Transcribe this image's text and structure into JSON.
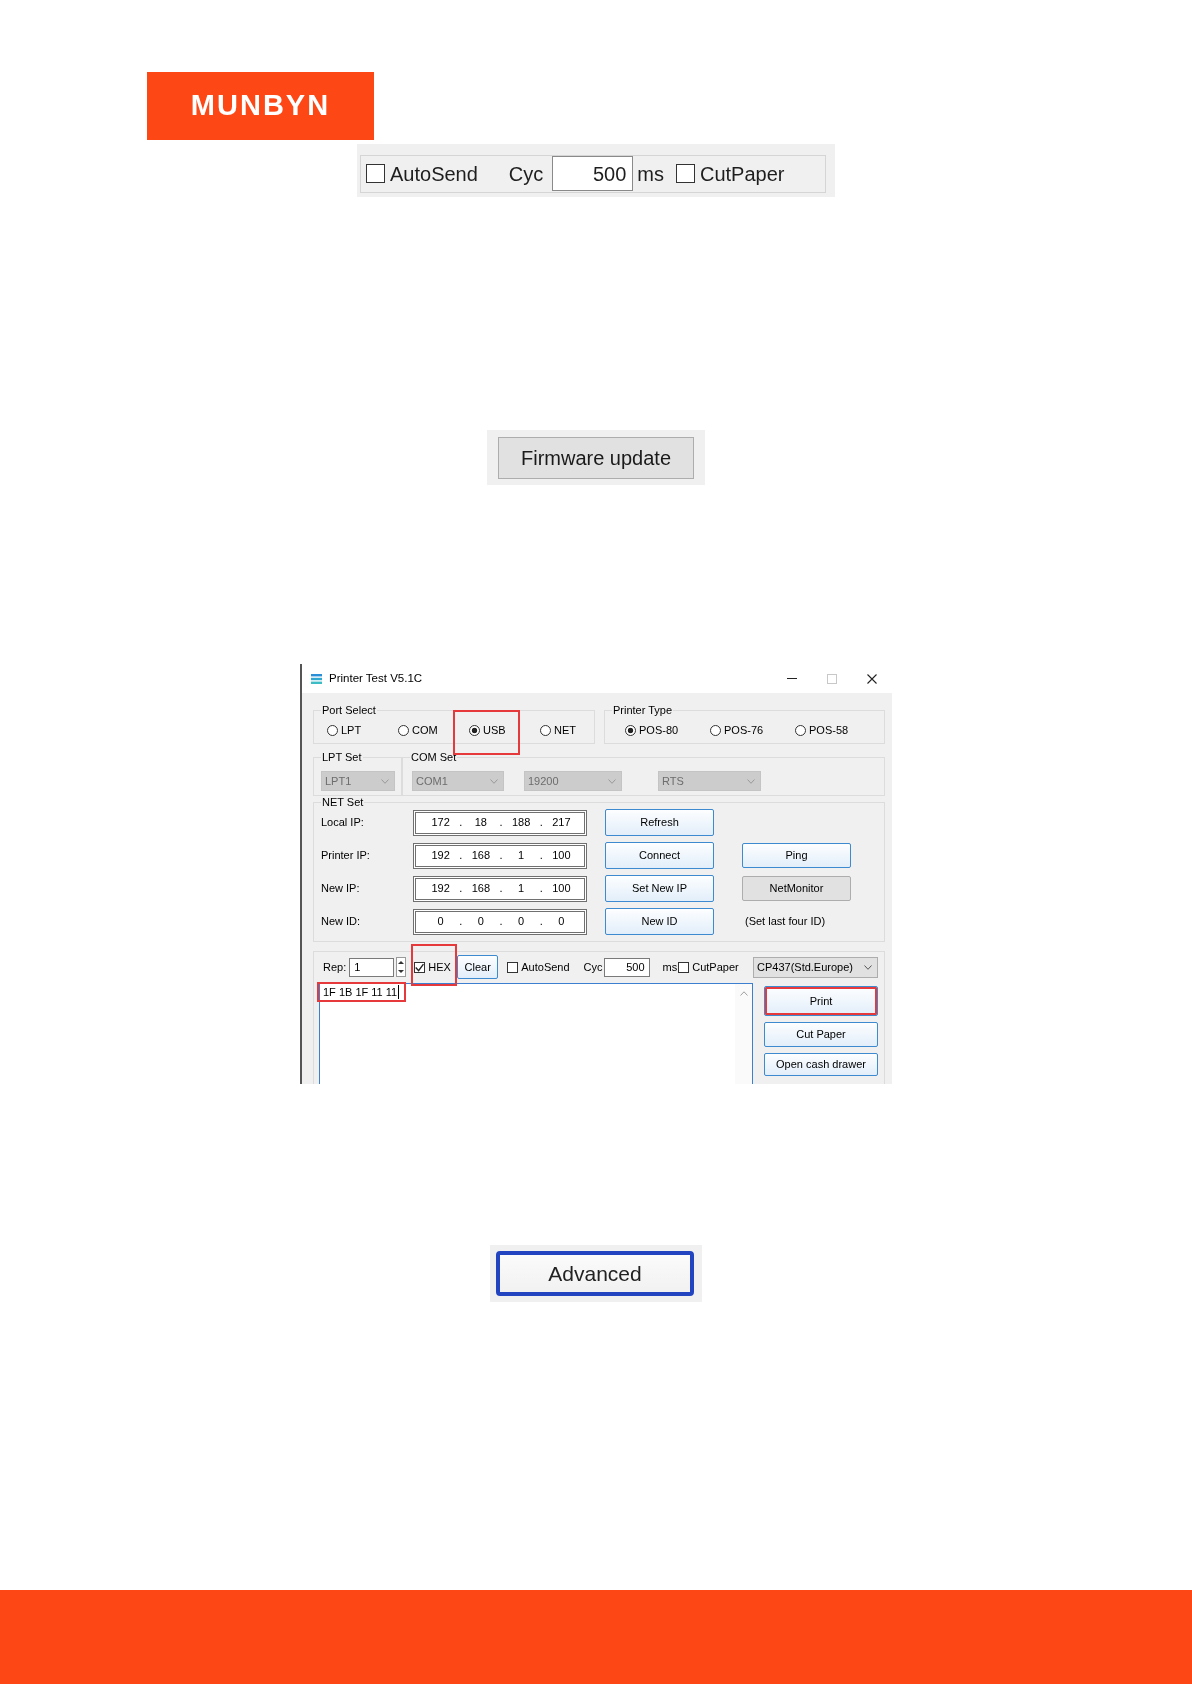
{
  "logo": {
    "text": "MUNBYN"
  },
  "options_panel": {
    "autosend": {
      "label": "AutoSend",
      "checked": false
    },
    "cyc_label": "Cyc",
    "cyc_value": "500",
    "unit": "ms",
    "cutpaper": {
      "label": "CutPaper",
      "checked": false
    }
  },
  "firmware_button": {
    "label": "Firmware update"
  },
  "window": {
    "title": "Printer Test V5.1C",
    "port_select": {
      "legend": "Port Select",
      "options": [
        {
          "label": "LPT",
          "selected": false,
          "highlighted": false
        },
        {
          "label": "COM",
          "selected": false,
          "highlighted": false
        },
        {
          "label": "USB",
          "selected": true,
          "highlighted": true
        },
        {
          "label": "NET",
          "selected": false,
          "highlighted": false
        }
      ]
    },
    "printer_type": {
      "legend": "Printer Type",
      "options": [
        {
          "label": "POS-80",
          "selected": true
        },
        {
          "label": "POS-76",
          "selected": false
        },
        {
          "label": "POS-58",
          "selected": false
        }
      ]
    },
    "lpt_set": {
      "legend": "LPT Set",
      "fields": [
        {
          "value": "LPT1",
          "disabled": true
        }
      ]
    },
    "com_set": {
      "legend": "COM Set",
      "fields": [
        {
          "value": "COM1",
          "disabled": true
        },
        {
          "value": "19200",
          "disabled": true
        },
        {
          "value": "RTS",
          "disabled": true
        }
      ]
    },
    "net_set": {
      "legend": "NET Set",
      "rows": [
        {
          "label": "Local IP:",
          "parts": [
            "172",
            ".",
            "18",
            ".",
            "188",
            ".",
            "217"
          ],
          "buttons": [
            {
              "label": "Refresh",
              "kind": "styled"
            }
          ]
        },
        {
          "label": "Printer IP:",
          "parts": [
            "192",
            ".",
            "168",
            ".",
            "1",
            ".",
            "100"
          ],
          "buttons": [
            {
              "label": "Connect",
              "kind": "styled"
            },
            {
              "label": "Ping",
              "kind": "styled"
            }
          ]
        },
        {
          "label": "New IP:",
          "parts": [
            "192",
            ".",
            "168",
            ".",
            "1",
            ".",
            "100"
          ],
          "buttons": [
            {
              "label": "Set New IP",
              "kind": "styled"
            },
            {
              "label": "NetMonitor",
              "kind": "plain"
            }
          ]
        },
        {
          "label": "New ID:",
          "parts": [
            "0",
            ".",
            "0",
            ".",
            "0",
            ".",
            "0"
          ],
          "buttons": [
            {
              "label": "New ID",
              "kind": "styled"
            }
          ],
          "note": "(Set last four ID)"
        }
      ]
    },
    "send": {
      "rep_label": "Rep:",
      "rep_value": "1",
      "hex": {
        "label": "HEX",
        "checked": true,
        "highlighted": true
      },
      "clear_button": "Clear",
      "autosend": {
        "label": "AutoSend",
        "checked": false
      },
      "cyc_label": "Cyc",
      "cyc_value": "500",
      "unit": "ms",
      "cutpaper": {
        "label": "CutPaper",
        "checked": false
      },
      "codepage": "CP437(Std.Europe)",
      "text": {
        "value": "1F 1B 1F 11 11",
        "highlighted": true
      },
      "buttons": [
        {
          "label": "Print",
          "highlighted": true
        },
        {
          "label": "Cut Paper",
          "highlighted": false
        },
        {
          "label": "Open cash drawer",
          "highlighted": false
        }
      ]
    }
  },
  "advanced_button": {
    "label": "Advanced"
  }
}
